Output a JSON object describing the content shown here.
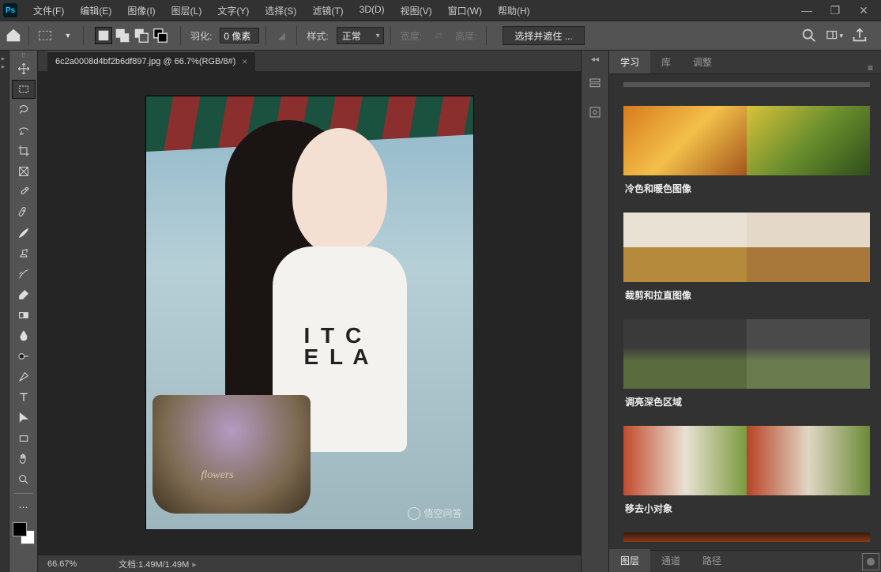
{
  "menubar": {
    "items": [
      "文件(F)",
      "编辑(E)",
      "图像(I)",
      "图层(L)",
      "文字(Y)",
      "选择(S)",
      "滤镜(T)",
      "3D(D)",
      "视图(V)",
      "窗口(W)",
      "帮助(H)"
    ]
  },
  "optionsbar": {
    "feather_label": "羽化:",
    "feather_value": "0 像素",
    "style_label": "样式:",
    "style_value": "正常",
    "width_label": "宽度:",
    "height_label": "高度:",
    "select_mask_btn": "选择并遮住 ..."
  },
  "document": {
    "tab_title": "6c2a0008d4bf2b6df897.jpg @ 66.7%(RGB/8#)",
    "basket_label": "flowers",
    "shirt_text_1": "I T C",
    "shirt_text_2": "E L A",
    "watermark": "悟空问答"
  },
  "statusbar": {
    "zoom": "66.67%",
    "doc_info": "文档:1.49M/1.49M"
  },
  "right_panel": {
    "tabs": [
      "学习",
      "库",
      "调整"
    ],
    "cards": [
      {
        "title": "冷色和暖色图像",
        "a": "thumb1a",
        "b": "thumb1b"
      },
      {
        "title": "裁剪和拉直图像",
        "a": "thumb2a",
        "b": "thumb2b"
      },
      {
        "title": "调亮深色区域",
        "a": "thumb3a",
        "b": "thumb3b"
      },
      {
        "title": "移去小对象",
        "a": "thumb4a",
        "b": "thumb4b"
      }
    ],
    "bottom_tabs": [
      "图层",
      "通道",
      "路径"
    ]
  }
}
